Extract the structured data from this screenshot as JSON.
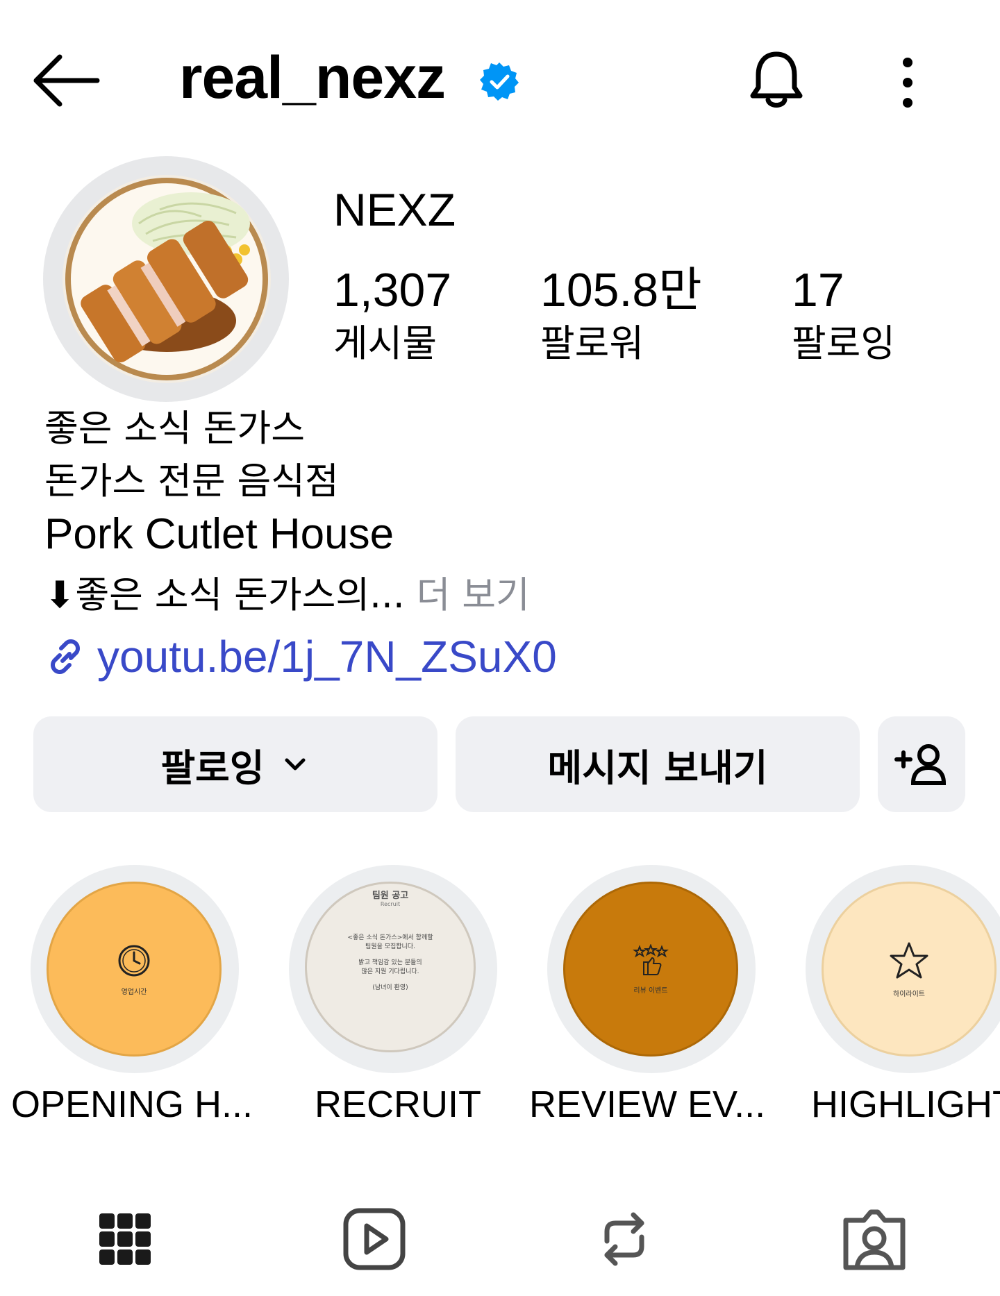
{
  "header": {
    "username": "real_nexz",
    "back_icon": "arrow-left-icon",
    "verified_icon": "verified-badge-icon",
    "bell_icon": "bell-icon",
    "more_icon": "more-vertical-icon"
  },
  "profile": {
    "display_name": "NEXZ",
    "stats": [
      {
        "value": "1,307",
        "label": "게시물"
      },
      {
        "value": "105.8만",
        "label": "팔로워"
      },
      {
        "value": "17",
        "label": "팔로잉"
      }
    ],
    "bio_lines": [
      "좋은 소식 돈가스",
      "돈가스 전문 음식점",
      "Pork Cutlet House"
    ],
    "bio_more_prefix": "⬇좋은 소식 돈가스의...",
    "bio_more_link": "더 보기",
    "link": "youtu.be/1j_7N_ZSuX0"
  },
  "actions": {
    "follow_label": "팔로잉",
    "message_label": "메시지 보내기",
    "add_user_icon": "add-person-icon"
  },
  "highlights": [
    {
      "label": "OPENING H...",
      "mini_text": "영업시간",
      "color": "#fcbb5a"
    },
    {
      "label": "RECRUIT",
      "mini_title": "팀원 공고",
      "mini_sub": "Recruit",
      "mini_lines": [
        "<좋은 소식 돈가스>에서 함께할",
        "팀원을 모집합니다.",
        "밝고 책임감 있는 분들의",
        "많은 지원 기다립니다.",
        "(남녀이 환영)"
      ],
      "color": "#efebe4"
    },
    {
      "label": "REVIEW EV...",
      "mini_text": "리뷰 이벤트",
      "color": "#c87a0c"
    },
    {
      "label": "HIGHLIGHT",
      "mini_text": "하이라이트",
      "color": "#fde6bf"
    }
  ],
  "tabs": [
    {
      "icon": "grid-icon"
    },
    {
      "icon": "reels-icon"
    },
    {
      "icon": "repost-icon"
    },
    {
      "icon": "tagged-icon"
    }
  ],
  "colors": {
    "link": "#3949c8",
    "verified": "#0095f6",
    "button_bg": "#eff0f3",
    "muted": "#8a8d95"
  }
}
